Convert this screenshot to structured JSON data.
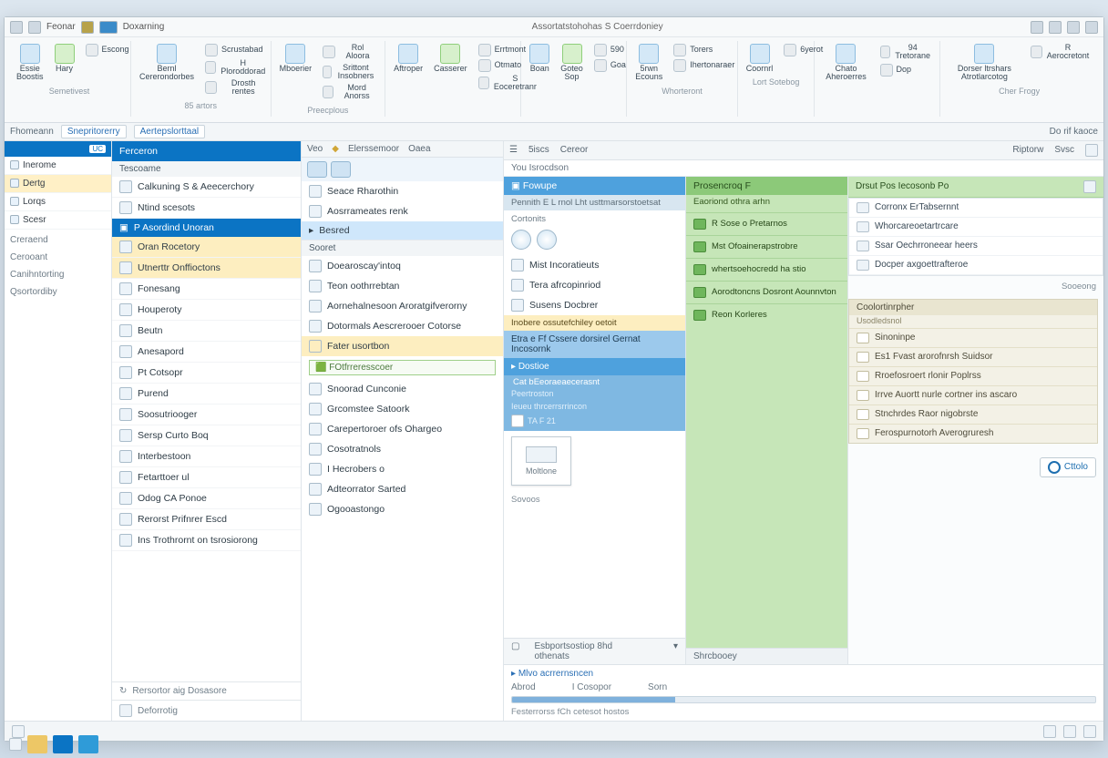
{
  "titlebar": {
    "left_items": [
      "Feonar",
      "Doxarning"
    ],
    "center": "Assortatstohohas  S  Coerrdoniey",
    "right_icons": [
      "sync-icon",
      "print-icon",
      "help-icon",
      "close-icon"
    ]
  },
  "ribbon": {
    "groups": [
      {
        "caption": "Semetivest",
        "big": [
          {
            "label": "Essie Boostis"
          },
          {
            "label": "Hary"
          }
        ],
        "small": [
          {
            "label": "Escong"
          }
        ]
      },
      {
        "caption": "85 artors",
        "big": [
          {
            "label": "Bernl Cererondorbes"
          }
        ],
        "small": [
          {
            "label": "Scrustabad"
          },
          {
            "label": "H Ploroddorad"
          },
          {
            "label": "Drosth rentes"
          }
        ]
      },
      {
        "caption": "Preecplous",
        "big": [
          {
            "label": "Mboerier"
          }
        ],
        "small": [
          {
            "label": "Rol Aloora"
          },
          {
            "label": "Srittont Insobners"
          },
          {
            "label": "Mord Anorss"
          }
        ]
      },
      {
        "caption": "",
        "big": [
          {
            "label": "Aftroper"
          },
          {
            "label": "Casserer"
          }
        ],
        "small": [
          {
            "label": "Errtmont"
          },
          {
            "label": "Otmato"
          },
          {
            "label": "S Eoceretranr"
          }
        ]
      },
      {
        "caption": "",
        "big": [
          {
            "label": "Boan"
          },
          {
            "label": "Goteo Sop"
          }
        ],
        "small": [
          {
            "label": "590"
          },
          {
            "label": "Goa"
          }
        ]
      },
      {
        "caption": "Whorteront",
        "big": [
          {
            "label": "5rwn Ecouns"
          }
        ],
        "small": [
          {
            "label": "Torers"
          },
          {
            "label": "Ihertonaraer"
          }
        ]
      },
      {
        "caption": "Lort Sotebog",
        "big": [
          {
            "label": "Coornrl"
          }
        ],
        "small": [
          {
            "label": "6yerot"
          }
        ]
      },
      {
        "caption": "",
        "big": [
          {
            "label": "Chato Aheroerres"
          }
        ],
        "small": [
          {
            "label": "94 Tretorane"
          },
          {
            "label": "Dop"
          }
        ]
      },
      {
        "caption": "Cher Frogy",
        "big": [
          {
            "label": "Dorser ltrshars Atrotlarcotog"
          }
        ],
        "small": [
          {
            "label": "R Aerocretont"
          }
        ]
      }
    ]
  },
  "formula": {
    "left": "Fhomeann",
    "pill1": "Snepritorerry",
    "pill2": "Aertepslorttaal",
    "right": "Do rif kaoce"
  },
  "nav1": {
    "header": "",
    "badge": "UC",
    "items": [
      {
        "label": "Inerome"
      },
      {
        "label": "Dertg",
        "sel": true
      },
      {
        "label": "Lorqs"
      },
      {
        "label": "Scesr"
      }
    ],
    "sections": [
      {
        "label": "Creraend"
      },
      {
        "label": "Cerooant"
      },
      {
        "label": "Canihntorting"
      },
      {
        "label": "Qsortordiby"
      }
    ]
  },
  "nav2": {
    "title": "Ferceron",
    "subtitle": "Tescoame",
    "group1": [
      {
        "label": "Calkuning S & Aeecerchory"
      },
      {
        "label": "Ntind scesots"
      }
    ],
    "header2": "P Asordind Unoran",
    "group2": [
      {
        "label": "Oran Rocetory"
      },
      {
        "label": "Utnerttr Onffioctons"
      },
      {
        "label": "Fonesang"
      },
      {
        "label": "Houperoty"
      },
      {
        "label": "Beutn"
      },
      {
        "label": "Anesapord"
      }
    ],
    "group3": [
      {
        "label": "Pt Cotsopr"
      },
      {
        "label": "Purend"
      },
      {
        "label": "Soosutriooger"
      },
      {
        "label": "Sersp Curto Boq"
      },
      {
        "label": "Interbestoon"
      },
      {
        "label": "Fetarttoer ul"
      },
      {
        "label": "Odog CA Ponoe"
      },
      {
        "label": "Rerorst Prifnrer Escd"
      },
      {
        "label": "Ins Trothrornt on tsrosiorong"
      }
    ],
    "footer1": "Rersortor aig Dosasore",
    "footer2": "Deforrotig"
  },
  "nav3": {
    "bar": [
      "Veo",
      "Elerssemoor",
      "Oaea"
    ],
    "items1": [
      {
        "label": "Seace Rharothin"
      },
      {
        "label": "Aosrrameates renk"
      }
    ],
    "header": "Besred",
    "section": "Sooret",
    "items2": [
      {
        "label": "Doearoscay'intoq"
      },
      {
        "label": "Teon oothrrebtan"
      },
      {
        "label": "Aornehalnesoon Aroratgifverorny"
      },
      {
        "label": "Dotormals Aescrerooer Cotorse"
      }
    ],
    "amberHeader": "Fater usortbon",
    "searchLabel": "FOtfrreresscoer",
    "items3": [
      {
        "label": "Snoorad Cunconie"
      },
      {
        "label": "Grcomstee Satoork"
      },
      {
        "label": "Carepertoroer ofs Ohargeo"
      },
      {
        "label": "Cosotratnols"
      },
      {
        "label": "I Hecrobers o"
      },
      {
        "label": "Adteorrator Sarted"
      },
      {
        "label": "Ogooastongo"
      }
    ]
  },
  "mainbar": {
    "items": [
      "5iscs",
      "Cereor",
      "Riptorw",
      "Svsc"
    ]
  },
  "viewtabs": "You  Isrocdson",
  "colA": {
    "title": "Fowupe",
    "subtitle": "Pennith E L rnol Lht usttmarsorstoetsat",
    "section": "Cortonits",
    "items": [
      {
        "label": "Mist Incoratieuts"
      },
      {
        "label": "Tera afrcopinriod"
      },
      {
        "label": "Susens Docbrer"
      }
    ],
    "amber": "Inobere ossutefchiley oetoit",
    "blueline": "Etra e Ff Cssere dorsirel Gernat Incosornk",
    "selHeader": "Dostioe",
    "selSub": "Cat bEeoraeaecerasnt",
    "selItems": [
      "Peertroston",
      "Ieueu thrcerrsrrincon"
    ],
    "dateline": "TA  F 21",
    "cardLabel": "Moltlone",
    "sourcesLabel": "Sovoos",
    "footTab": "Esbportsostiop 8hd othenats"
  },
  "colB": {
    "header": "Prosencroq F",
    "sub": "Eaoriond othra arhn",
    "rows": [
      "R Sose o Pretarnos",
      "Mst Ofoainerapstrobre",
      "whertsoehocredd ha stio",
      "Aorodtoncns Dosront Aounnvton",
      "Reon Korleres"
    ],
    "footTab": "Shrcbooey"
  },
  "colC": {
    "topTitle": "Drsut Pos Iecosonb Po",
    "listItems": [
      "Corronx ErTabsernnt",
      "Whorcareoetartrcare",
      "Ssar Oechrroneear heers",
      "Docper axgoettrafteroe"
    ],
    "ctaLabel": "Cttolo",
    "smallLabel": "Sooeong",
    "panelHeader": "Coolortinrpher",
    "panelSub": "Usodledsnol",
    "panelRows": [
      "Sinoninpe",
      "Es1  Fvast arorofnrsh Suidsor",
      "Rroefosroert rlonir Poplrss",
      "Irrve  Auortt nurle cortner ins ascaro",
      "Stnchrdes Raor nigobrste",
      "Ferospurnotorh Averogruresh"
    ]
  },
  "bottom": {
    "label": "Mlvo acrrernsncen",
    "tabs": [
      "Abrod",
      "I Cosopor",
      "Sorn"
    ],
    "progressLabel": "Festerrorss fCh cetesot hostos"
  },
  "status": {
    "right_icons": [
      "x",
      "u",
      "s"
    ]
  }
}
